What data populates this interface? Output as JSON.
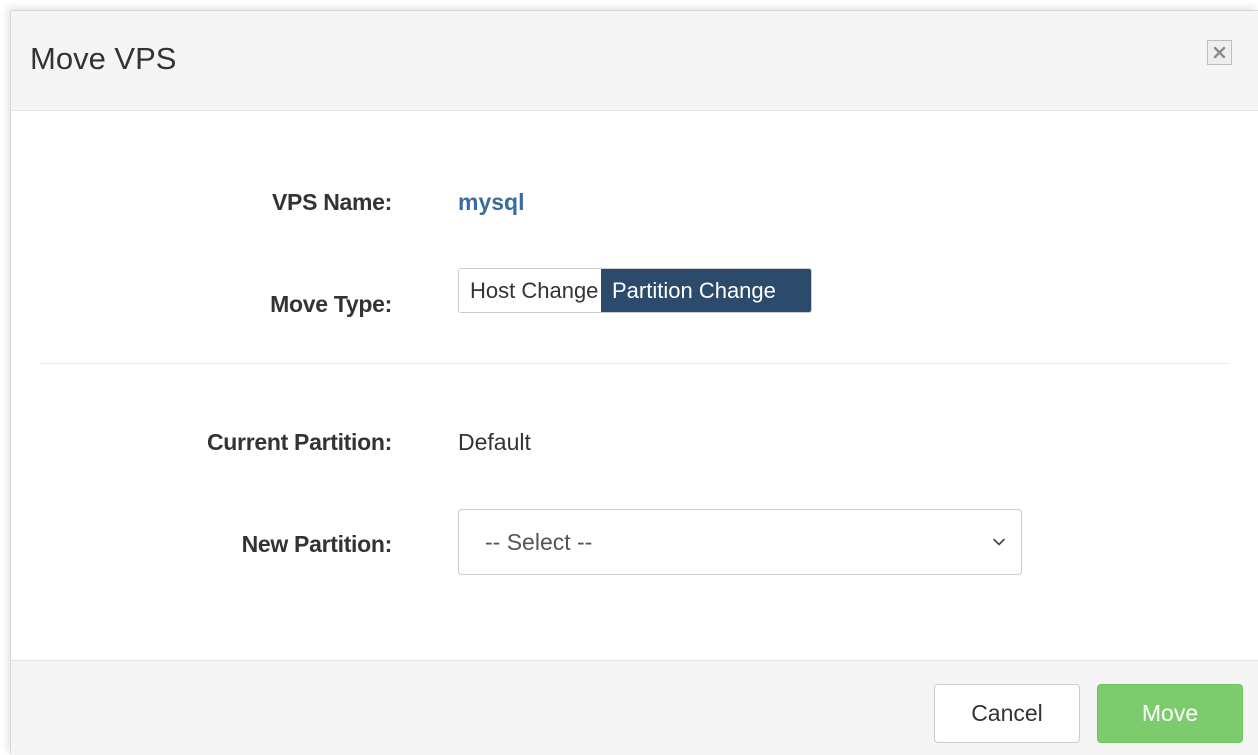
{
  "dialog": {
    "title": "Move VPS",
    "close_icon": "close-icon"
  },
  "form": {
    "vps_name_label": "VPS Name:",
    "vps_name_value": "mysql",
    "move_type_label": "Move Type:",
    "move_type_options": [
      "Host Change",
      "Partition Change"
    ],
    "move_type_selected": "Partition Change",
    "current_partition_label": "Current Partition:",
    "current_partition_value": "Default",
    "new_partition_label": "New Partition:",
    "new_partition_selected": "-- Select --"
  },
  "footer": {
    "cancel_label": "Cancel",
    "move_label": "Move"
  },
  "colors": {
    "accent_link": "#3a6c9e",
    "toggle_active": "#2c4a6b",
    "primary_button": "#7ccc6d"
  }
}
